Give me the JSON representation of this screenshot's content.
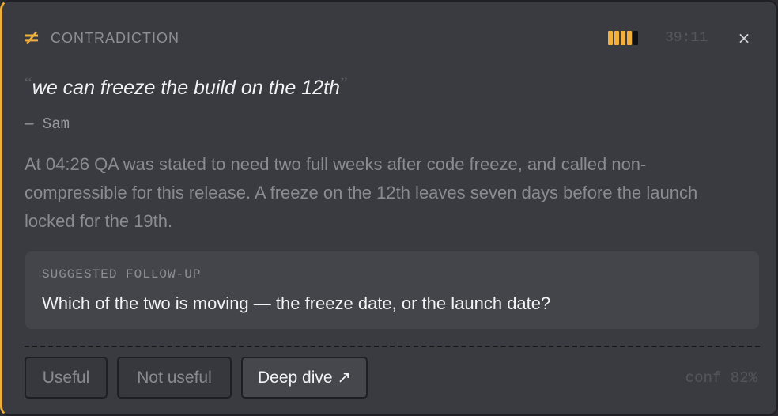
{
  "card": {
    "accent_color": "#f0b03a",
    "type_glyph": "≠",
    "type_label": "CONTRADICTION",
    "meter": {
      "level": 4,
      "total": 5,
      "filled_color": "#f0b03a",
      "empty_color": "#111114"
    },
    "timestamp": "39:11",
    "close_icon": "close-icon",
    "close_glyph": "×"
  },
  "quote": {
    "open_mark": "“",
    "text": "we can freeze the build on the 12th",
    "close_mark": "”",
    "speaker": "— Sam"
  },
  "explanation": "At 04:26 QA was stated to need two full weeks after code freeze, and called non-compressible for this release. A freeze on the 12th leaves seven days before the launch locked for the 19th.",
  "followup": {
    "label": "SUGGESTED FOLLOW-UP",
    "text": "Which of the two is moving — the freeze date, or the launch date?"
  },
  "actions": {
    "useful": "Useful",
    "not_useful": "Not useful",
    "deep_dive": "Deep dive ↗"
  },
  "confidence": "conf 82%"
}
